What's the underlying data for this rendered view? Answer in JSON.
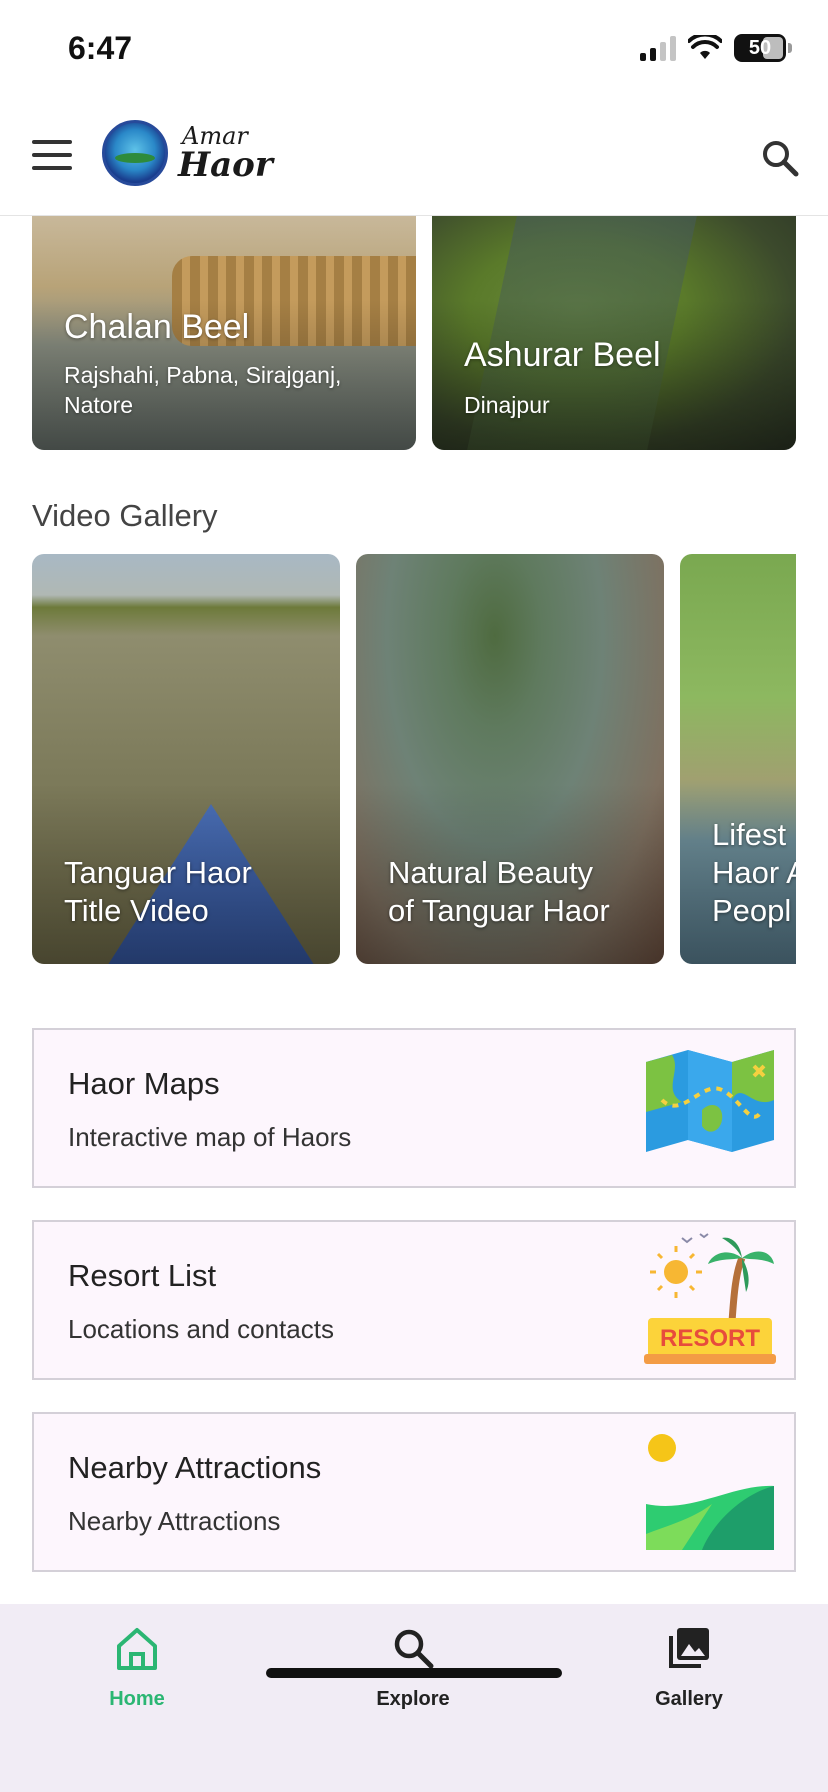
{
  "status_bar": {
    "time": "6:47",
    "battery": "50"
  },
  "header": {
    "menu_icon": "hamburger-menu-icon",
    "logo_line1": "Amar",
    "logo_line2": "Haor",
    "search_icon": "search-icon"
  },
  "beels": [
    {
      "title": "Chalan Beel",
      "subtitle_line1": "Rajshahi, Pabna, Sirajganj,",
      "subtitle_line2": "Natore"
    },
    {
      "title": "Ashurar Beel",
      "subtitle_line1": "Dinajpur"
    }
  ],
  "video_gallery": {
    "heading": "Video Gallery",
    "videos": [
      {
        "line1": "Tanguar Haor",
        "line2": "Title Video"
      },
      {
        "line1": "Natural Beauty",
        "line2": "of Tanguar Haor"
      },
      {
        "line1": "Lifest",
        "line2": "Haor A",
        "line3": "Peopl"
      }
    ]
  },
  "features": [
    {
      "title": "Haor Maps",
      "subtitle": "Interactive map of Haors",
      "icon": "map-icon"
    },
    {
      "title": "Resort List",
      "subtitle": "Locations and contacts",
      "icon": "resort-icon",
      "icon_text": "RESORT"
    },
    {
      "title": "Nearby Attractions",
      "subtitle": "Nearby Attractions",
      "icon": "landscape-icon"
    }
  ],
  "bottom_nav": {
    "items": [
      {
        "label": "Home",
        "icon": "home-icon",
        "active": true
      },
      {
        "label": "Explore",
        "icon": "search-icon",
        "active": false
      },
      {
        "label": "Gallery",
        "icon": "gallery-icon",
        "active": false
      }
    ]
  },
  "colors": {
    "accent": "#2bb673",
    "card_background": "#fdf6fd",
    "nav_background": "#f1ecf5"
  }
}
